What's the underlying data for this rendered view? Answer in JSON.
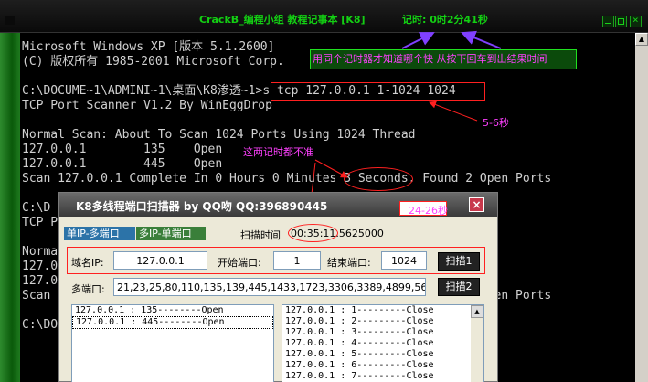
{
  "window": {
    "title": "CrackB_编程小组 教程记事本 [K8]",
    "timer": "记时: 0时2分41秒"
  },
  "console": {
    "lines": [
      "Microsoft Windows XP [版本 5.1.2600]",
      "(C) 版权所有 1985-2001 Microsoft Corp.",
      "",
      "C:\\DOCUME~1\\ADMINI~1\\桌面\\K8渗透~1>s tcp 127.0.0.1 1-1024 1024",
      "TCP Port Scanner V1.2 By WinEggDrop",
      "",
      "Normal Scan: About To Scan 1024 Ports Using 1024 Thread",
      "127.0.0.1        135    Open",
      "127.0.0.1        445    Open",
      "Scan 127.0.0.1 Complete In 0 Hours 0 Minutes 3 Seconds. Found 2 Open Ports",
      "",
      "C:\\D",
      "TCP P",
      "",
      "Norma",
      "127.0",
      "127.0",
      "Scan                                                             pen Ports",
      "",
      "C:\\DO"
    ]
  },
  "annotations": {
    "note_same_timer": "用同个记时器才知道哪个快  从按下回车到出结果时间",
    "note_5_6s": "5-6秒",
    "note_both_inaccurate": "这两记时都不准",
    "note_24_26s": "24-26秒"
  },
  "dialog": {
    "title": "K8多线程端口扫描器 by QQ吻 QQ:396890445",
    "close_label": "×",
    "tabs": [
      "单IP-多端口",
      "多IP-单端口"
    ],
    "scan_time_label": "扫描时间",
    "scan_time_value": "00:35:11.5625000",
    "domain_ip_label": "域名IP:",
    "domain_ip_value": "127.0.0.1",
    "start_port_label": "开始端口:",
    "start_port_value": "1",
    "end_port_label": "结束端口:",
    "end_port_value": "1024",
    "scan1_label": "扫描1",
    "multi_port_label": "多端口:",
    "multi_port_value": "21,23,25,80,110,135,139,445,1433,1723,3306,3389,4899,56",
    "scan2_label": "扫描2",
    "open_results": [
      "127.0.0.1 : 135--------Open",
      "127.0.0.1 : 445--------Open"
    ],
    "close_results": [
      "127.0.0.1 : 1---------Close",
      "127.0.0.1 : 2---------Close",
      "127.0.0.1 : 3---------Close",
      "127.0.0.1 : 4---------Close",
      "127.0.0.1 : 5---------Close",
      "127.0.0.1 : 6---------Close",
      "127.0.0.1 : 7---------Close"
    ]
  }
}
